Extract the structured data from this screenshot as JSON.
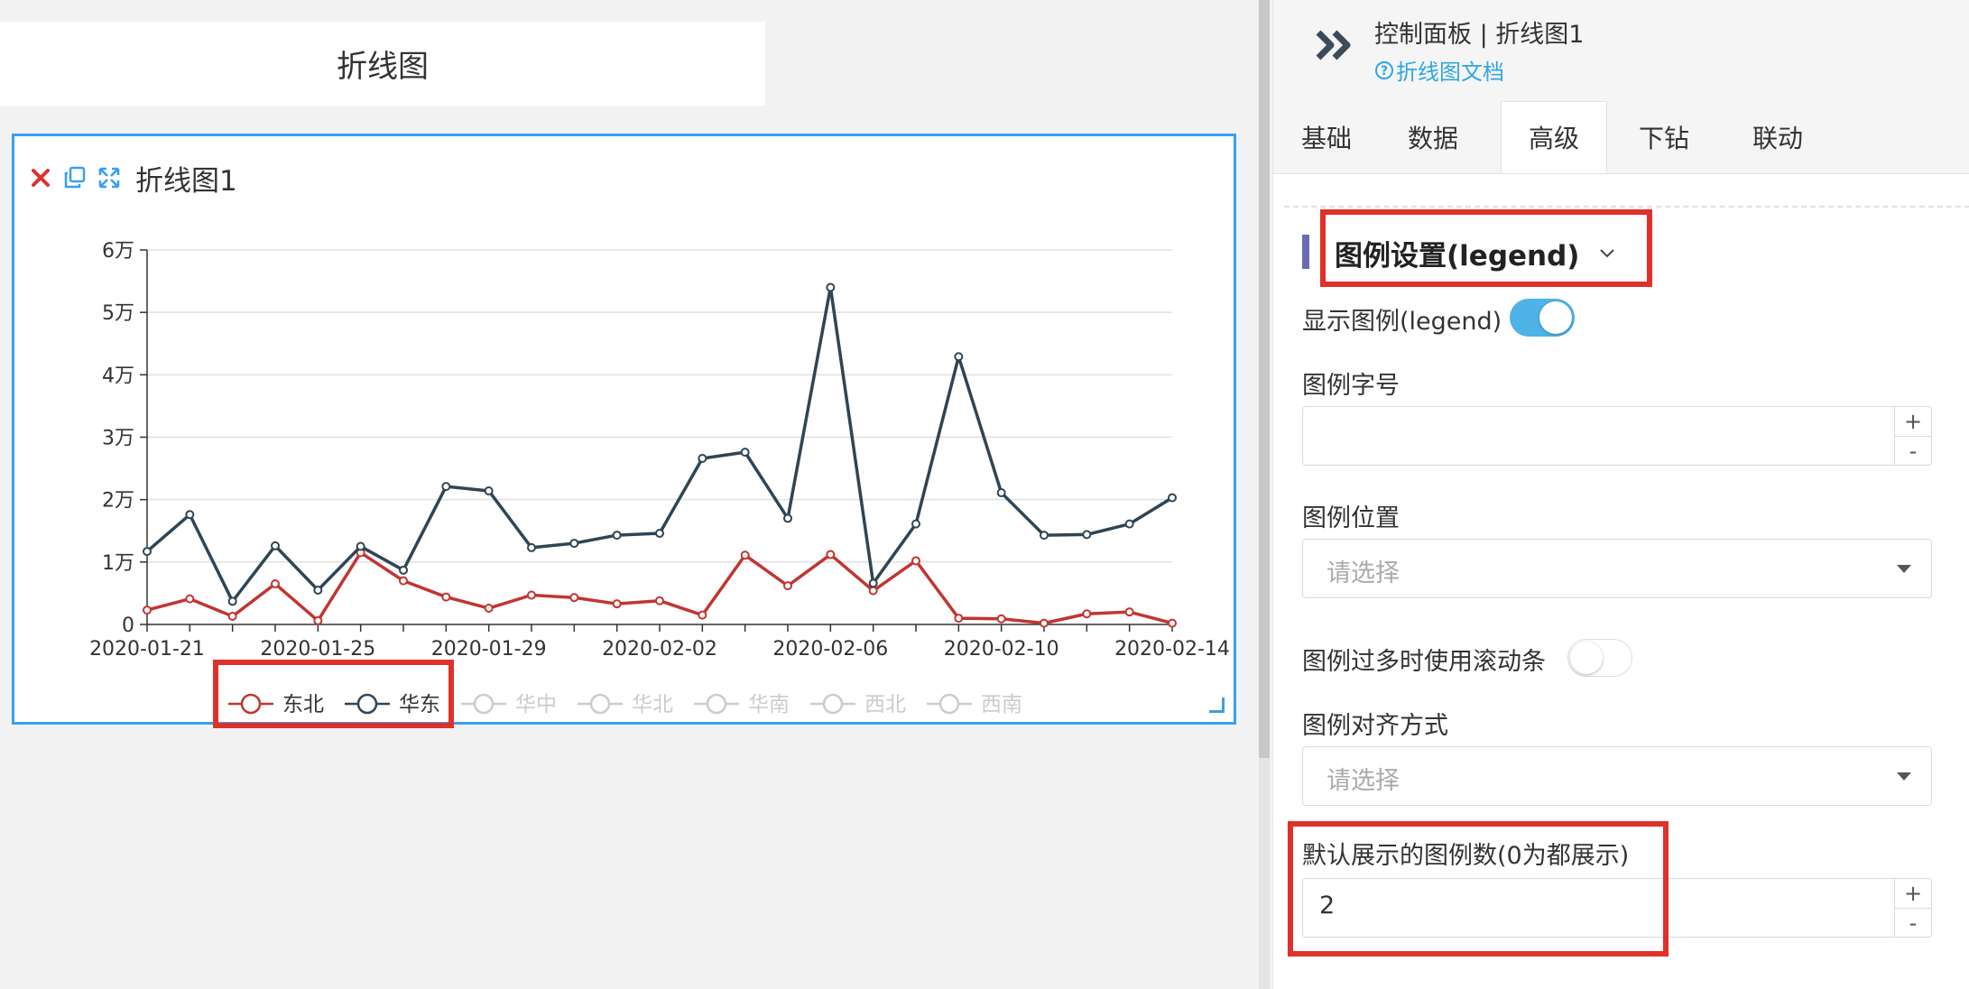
{
  "canvas": {
    "title_card": "折线图",
    "chart_panel_title": "折线图1"
  },
  "chart_data": {
    "type": "line",
    "x": [
      "2020-01-21",
      "2020-01-22",
      "2020-01-23",
      "2020-01-24",
      "2020-01-25",
      "2020-01-26",
      "2020-01-27",
      "2020-01-28",
      "2020-01-29",
      "2020-01-30",
      "2020-01-31",
      "2020-02-01",
      "2020-02-02",
      "2020-02-03",
      "2020-02-04",
      "2020-02-05",
      "2020-02-06",
      "2020-02-07",
      "2020-02-08",
      "2020-02-09",
      "2020-02-10",
      "2020-02-11",
      "2020-02-12",
      "2020-02-13",
      "2020-02-14"
    ],
    "xtick_labels": [
      "2020-01-21",
      "2020-01-25",
      "2020-01-29",
      "2020-02-02",
      "2020-02-06",
      "2020-02-10",
      "2020-02-14"
    ],
    "ytick_labels": [
      "0",
      "1万",
      "2万",
      "3万",
      "4万",
      "5万",
      "6万"
    ],
    "ylim": [
      0,
      60000
    ],
    "grid": true,
    "legend_placement": "bottom",
    "series": [
      {
        "name": "东北",
        "color": "#c23531",
        "visible": true,
        "values": [
          2300,
          4100,
          1300,
          6500,
          600,
          11500,
          7000,
          4400,
          2600,
          4700,
          4300,
          3300,
          3800,
          1500,
          11100,
          6200,
          11200,
          5400,
          10200,
          1000,
          900,
          200,
          1700,
          2000,
          200
        ]
      },
      {
        "name": "华东",
        "color": "#2f4554",
        "visible": true,
        "values": [
          11700,
          17600,
          3700,
          12600,
          5500,
          12500,
          8700,
          22100,
          21400,
          12300,
          13000,
          14300,
          14600,
          26600,
          27600,
          17000,
          54000,
          6600,
          16100,
          42900,
          21100,
          14300,
          14400,
          16100,
          20300
        ]
      },
      {
        "name": "华中",
        "visible": false
      },
      {
        "name": "华北",
        "visible": false
      },
      {
        "name": "华南",
        "visible": false
      },
      {
        "name": "西北",
        "visible": false
      },
      {
        "name": "西南",
        "visible": false
      }
    ],
    "inactive_color": "#cccccc"
  },
  "panel": {
    "title": "控制面板 | 折线图1",
    "doc_link": "折线图文档",
    "tabs": [
      "基础",
      "数据",
      "高级",
      "下钻",
      "联动"
    ],
    "active_tab": "高级",
    "section_title": "图例设置(legend)",
    "show_legend_label": "显示图例(legend)",
    "show_legend_on": true,
    "font_size_label": "图例字号",
    "font_size_value": "",
    "position_label": "图例位置",
    "position_placeholder": "请选择",
    "scroll_label": "图例过多时使用滚动条",
    "scroll_on": false,
    "align_label": "图例对齐方式",
    "align_placeholder": "请选择",
    "default_count_label": "默认展示的图例数(0为都展示)",
    "default_count_value": "2",
    "stepper_plus": "+",
    "stepper_minus": "-"
  },
  "colors": {
    "accent": "#3a9ff0",
    "highlight": "#e0302a",
    "toggle_on": "#4db3e6",
    "link": "#2ea7e0"
  }
}
